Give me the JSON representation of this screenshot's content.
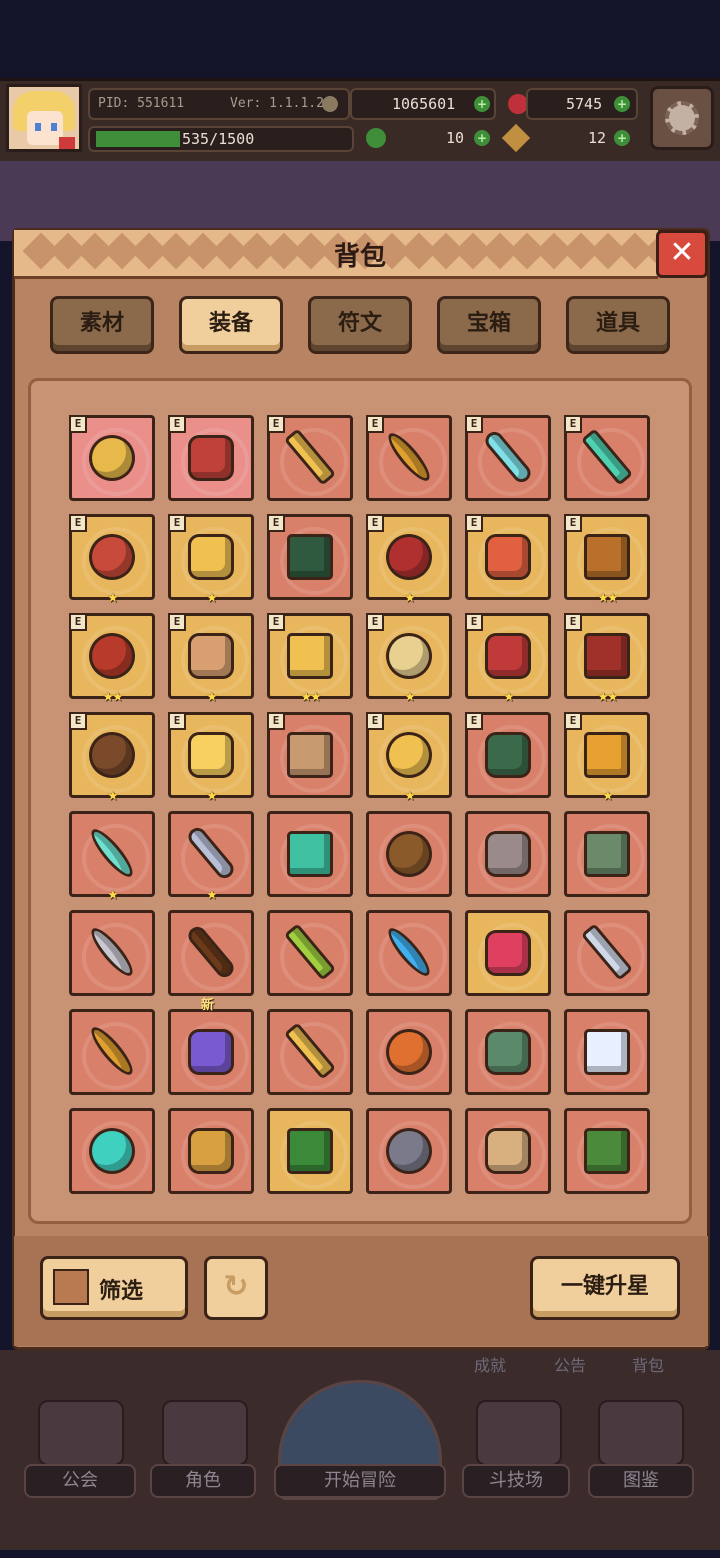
{
  "status": {
    "pid": "PID: 551611",
    "version": "Ver: 1.1.1.2",
    "gold": "1065601",
    "gems": "5745",
    "exp": "535/1500",
    "clover": "10",
    "keys": "12"
  },
  "panel": {
    "title": "背包",
    "close_glyph": "✕"
  },
  "tabs": [
    {
      "label": "素材",
      "active": false
    },
    {
      "label": "装备",
      "active": true
    },
    {
      "label": "符文",
      "active": false
    },
    {
      "label": "宝箱",
      "active": false
    },
    {
      "label": "道具",
      "active": false
    }
  ],
  "equip_badge": "E",
  "new_badge": "新",
  "items": [
    {
      "name": "straw-hat-icon",
      "bg": "pink",
      "e": true,
      "stars": "",
      "color": "#e7b84a"
    },
    {
      "name": "red-helmet-icon",
      "bg": "pink",
      "e": true,
      "stars": "",
      "color": "#c0403a"
    },
    {
      "name": "gold-scepter-icon",
      "bg": "",
      "e": true,
      "stars": "",
      "color": "#f0c050"
    },
    {
      "name": "golden-mace-icon",
      "bg": "",
      "e": true,
      "stars": "",
      "color": "#e0a030"
    },
    {
      "name": "ice-staff-icon",
      "bg": "",
      "e": true,
      "stars": "",
      "color": "#7fe0e8"
    },
    {
      "name": "jade-spear-icon",
      "bg": "",
      "e": true,
      "stars": "",
      "color": "#4fd0b0"
    },
    {
      "name": "sun-amulet-icon",
      "bg": "gold",
      "e": true,
      "stars": "★",
      "color": "#c84a3a"
    },
    {
      "name": "gold-ring-icon",
      "bg": "gold",
      "e": true,
      "stars": "★",
      "color": "#f0c050"
    },
    {
      "name": "green-hood-icon",
      "bg": "",
      "e": true,
      "stars": "",
      "color": "#2f5a3f"
    },
    {
      "name": "royal-robe-icon",
      "bg": "gold",
      "e": true,
      "stars": "★",
      "color": "#b03030"
    },
    {
      "name": "winged-armor-icon",
      "bg": "gold",
      "e": true,
      "stars": "",
      "color": "#e06040"
    },
    {
      "name": "gilded-boot-icon",
      "bg": "gold",
      "e": true,
      "stars": "★★",
      "color": "#b8702a"
    },
    {
      "name": "red-gauntlet-icon",
      "bg": "gold",
      "e": true,
      "stars": "★★",
      "color": "#b83a2a"
    },
    {
      "name": "spiked-ring-icon",
      "bg": "gold",
      "e": true,
      "stars": "★",
      "color": "#d8a070"
    },
    {
      "name": "jeweled-ring-icon",
      "bg": "gold",
      "e": true,
      "stars": "★★",
      "color": "#f0c050"
    },
    {
      "name": "silver-ring-icon",
      "bg": "gold",
      "e": true,
      "stars": "★",
      "color": "#e8d090"
    },
    {
      "name": "ruby-ring-icon",
      "bg": "gold",
      "e": true,
      "stars": "★",
      "color": "#c03a3a"
    },
    {
      "name": "dragon-gloves-icon",
      "bg": "gold",
      "e": true,
      "stars": "★★",
      "color": "#a0302a"
    },
    {
      "name": "leather-boots-icon",
      "bg": "gold",
      "e": true,
      "stars": "★",
      "color": "#7a4a2a"
    },
    {
      "name": "star-emblem-icon",
      "bg": "gold",
      "e": true,
      "stars": "★",
      "color": "#f8d060"
    },
    {
      "name": "shell-icon",
      "bg": "",
      "e": true,
      "stars": "",
      "color": "#c89a70"
    },
    {
      "name": "gold-necklace-icon",
      "bg": "gold",
      "e": true,
      "stars": "★",
      "color": "#f0c050"
    },
    {
      "name": "heart-necklace-icon",
      "bg": "",
      "e": true,
      "stars": "",
      "color": "#3a6a4a"
    },
    {
      "name": "gold-bracelet-icon",
      "bg": "gold",
      "e": true,
      "stars": "★",
      "color": "#e8a030"
    },
    {
      "name": "crystal-wand-icon",
      "bg": "",
      "e": false,
      "stars": "★",
      "color": "#6fe0d0"
    },
    {
      "name": "steel-sword-icon",
      "bg": "",
      "e": false,
      "stars": "★",
      "color": "#b8c0d8"
    },
    {
      "name": "jade-bow-icon",
      "bg": "",
      "e": false,
      "stars": "",
      "color": "#3fc0a0"
    },
    {
      "name": "wooden-crossbow-icon",
      "bg": "",
      "e": false,
      "stars": "",
      "color": "#8a5a2a"
    },
    {
      "name": "iron-crossbow-icon",
      "bg": "",
      "e": false,
      "stars": "",
      "color": "#9a8a8a"
    },
    {
      "name": "stone-tablet-icon",
      "bg": "",
      "e": false,
      "stars": "",
      "color": "#6a8a6a"
    },
    {
      "name": "battle-axe-icon",
      "bg": "",
      "e": false,
      "stars": "",
      "color": "#c8c8d0"
    },
    {
      "name": "wooden-club-icon",
      "bg": "",
      "e": false,
      "stars": "",
      "color": "#6a3a1a"
    },
    {
      "name": "emerald-scepter-icon",
      "bg": "",
      "e": false,
      "stars": "",
      "color": "#a0d040"
    },
    {
      "name": "sapphire-staff-icon",
      "bg": "",
      "e": false,
      "stars": "",
      "color": "#40b0f0"
    },
    {
      "name": "teddy-bear-icon",
      "bg": "gold",
      "e": false,
      "stars": "",
      "color": "#e04060"
    },
    {
      "name": "crossed-swords-icon",
      "bg": "",
      "e": false,
      "stars": "",
      "color": "#d0d8e8"
    },
    {
      "name": "arrow-icon",
      "bg": "",
      "e": false,
      "stars": "",
      "color": "#e0a030"
    },
    {
      "name": "purple-crossbow-icon",
      "bg": "",
      "e": false,
      "stars": "",
      "color": "#7a5ad0",
      "is_new": true
    },
    {
      "name": "golden-arrow-icon",
      "bg": "",
      "e": false,
      "stars": "",
      "color": "#f0c050"
    },
    {
      "name": "fire-armor-icon",
      "bg": "",
      "e": false,
      "stars": "",
      "color": "#e07030"
    },
    {
      "name": "turtle-shell-icon",
      "bg": "",
      "e": false,
      "stars": "",
      "color": "#5a8a6a"
    },
    {
      "name": "pearl-icon",
      "bg": "",
      "e": false,
      "stars": "",
      "color": "#e8f0ff"
    },
    {
      "name": "teal-orb-icon",
      "bg": "",
      "e": false,
      "stars": "",
      "color": "#40d0c0"
    },
    {
      "name": "knight-shield-icon",
      "bg": "",
      "e": false,
      "stars": "",
      "color": "#d8a040"
    },
    {
      "name": "green-cap-icon",
      "bg": "gold",
      "e": false,
      "stars": "",
      "color": "#3a8a3a"
    },
    {
      "name": "gray-hood-icon",
      "bg": "",
      "e": false,
      "stars": "",
      "color": "#7a7a8a"
    },
    {
      "name": "tan-cloak-icon",
      "bg": "",
      "e": false,
      "stars": "",
      "color": "#d8b080"
    },
    {
      "name": "green-helmet-icon",
      "bg": "",
      "e": false,
      "stars": "",
      "color": "#4a8a3a"
    }
  ],
  "footer": {
    "filter_label": "筛选",
    "refresh_glyph": "↻",
    "upgrade_label": "一键升星"
  },
  "subtabs": [
    "成就",
    "公告",
    "背包"
  ],
  "nav": [
    "公会",
    "角色",
    "开始冒险",
    "斗技场",
    "图鉴"
  ]
}
